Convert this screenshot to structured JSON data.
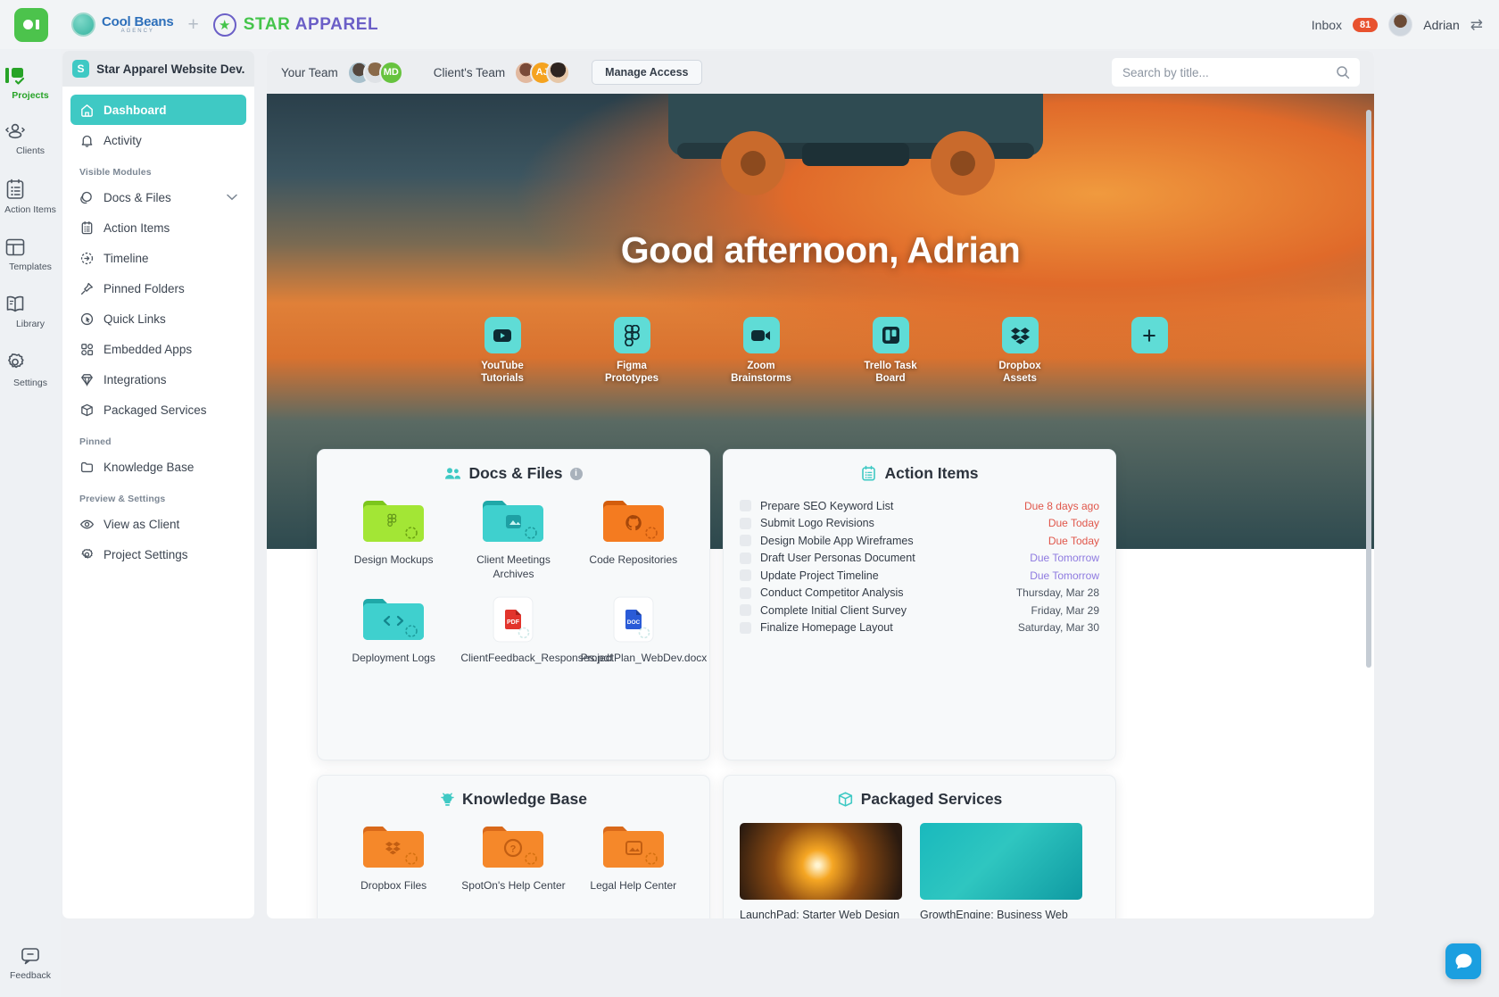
{
  "topbar": {
    "agency_name": "Cool Beans",
    "agency_sub": "AGENCY",
    "brand_part1": "STAR",
    "brand_part2": "APPAREL",
    "inbox_label": "Inbox",
    "inbox_count": "81",
    "user_name": "Adrian"
  },
  "rail": {
    "items": [
      {
        "label": "Projects",
        "icon": "projects-icon"
      },
      {
        "label": "Clients",
        "icon": "clients-icon"
      },
      {
        "label": "Action Items",
        "icon": "action-items-icon"
      },
      {
        "label": "Templates",
        "icon": "templates-icon"
      },
      {
        "label": "Library",
        "icon": "library-icon"
      },
      {
        "label": "Settings",
        "icon": "gear-icon"
      }
    ],
    "feedback_label": "Feedback"
  },
  "sidebar": {
    "project_initial": "S",
    "project_title": "Star Apparel Website Dev...",
    "dashboard_label": "Dashboard",
    "activity_label": "Activity",
    "section_modules": "Visible Modules",
    "section_pinned": "Pinned",
    "section_preview": "Preview & Settings",
    "modules": [
      {
        "label": "Docs & Files",
        "icon": "docs-files-icon",
        "chevron": "⌄"
      },
      {
        "label": "Action Items",
        "icon": "action-items-icon"
      },
      {
        "label": "Timeline",
        "icon": "timeline-icon"
      },
      {
        "label": "Pinned Folders",
        "icon": "pin-icon"
      },
      {
        "label": "Quick Links",
        "icon": "quick-links-icon"
      },
      {
        "label": "Embedded Apps",
        "icon": "embedded-apps-icon"
      },
      {
        "label": "Integrations",
        "icon": "integrations-icon"
      },
      {
        "label": "Packaged Services",
        "icon": "packaged-services-icon"
      }
    ],
    "pinned": [
      {
        "label": "Knowledge Base",
        "icon": "folder-icon"
      }
    ],
    "preview": [
      {
        "label": "View as Client",
        "icon": "eye-icon"
      },
      {
        "label": "Project Settings",
        "icon": "gear-icon"
      }
    ]
  },
  "main_top": {
    "your_team_label": "Your Team",
    "your_team_initials": "MD",
    "clients_team_label": "Client's Team",
    "clients_team_initials": "AJ",
    "manage_access_label": "Manage Access",
    "search_placeholder": "Search by title...",
    "search_value": ""
  },
  "hero": {
    "greeting": "Good afternoon, Adrian",
    "quick_links": [
      {
        "label": "YouTube\nTutorials",
        "line1": "YouTube",
        "line2": "Tutorials",
        "icon": "youtube-icon"
      },
      {
        "label": "Figma Prototypes",
        "line1": "Figma",
        "line2": "Prototypes",
        "icon": "figma-icon"
      },
      {
        "label": "Zoom Brainstorms",
        "line1": "Zoom",
        "line2": "Brainstorms",
        "icon": "zoom-icon"
      },
      {
        "label": "Trello Task Board",
        "line1": "Trello Task",
        "line2": "Board",
        "icon": "trello-icon"
      },
      {
        "label": "Dropbox Assets",
        "line1": "Dropbox",
        "line2": "Assets",
        "icon": "dropbox-icon"
      },
      {
        "label": "Add",
        "line1": "",
        "line2": "",
        "icon": "plus-icon"
      }
    ]
  },
  "docs_files": {
    "title": "Docs & Files",
    "info_glyph": "i",
    "items": [
      {
        "name": "Design Mockups",
        "type": "folder",
        "color": "#a3e635",
        "glyph": "figma-icon"
      },
      {
        "name": "Client Meetings Archives",
        "type": "folder",
        "color": "#3fd0ce",
        "glyph": "image-icon"
      },
      {
        "name": "Code Repositories",
        "type": "folder",
        "color": "#f47b20",
        "glyph": "github-icon"
      },
      {
        "name": "Deployment Logs",
        "type": "folder",
        "color": "#3fd0ce",
        "glyph": "code-icon"
      },
      {
        "name": "ClientFeedback_Responses.pdf",
        "type": "file",
        "color": "#e2342c",
        "glyph": "pdf-icon"
      },
      {
        "name": "ProjectPlan_WebDev.docx",
        "type": "file",
        "color": "#2a5bd7",
        "glyph": "doc-icon"
      }
    ]
  },
  "action_items": {
    "title": "Action Items",
    "rows": [
      {
        "name": "Prepare SEO Keyword List",
        "due": "Due 8 days ago",
        "due_style": "due-red"
      },
      {
        "name": "Submit Logo Revisions",
        "due": "Due Today",
        "due_style": "due-red"
      },
      {
        "name": "Design Mobile App Wireframes",
        "due": "Due Today",
        "due_style": "due-red"
      },
      {
        "name": "Draft User Personas Document",
        "due": "Due Tomorrow",
        "due_style": "due-purple"
      },
      {
        "name": "Update Project Timeline",
        "due": "Due Tomorrow",
        "due_style": "due-purple"
      },
      {
        "name": "Conduct Competitor Analysis",
        "due": "Thursday, Mar 28",
        "due_style": "due-grey"
      },
      {
        "name": "Complete Initial Client Survey",
        "due": "Friday, Mar 29",
        "due_style": "due-grey"
      },
      {
        "name": "Finalize Homepage Layout",
        "due": "Saturday, Mar 30",
        "due_style": "due-grey"
      }
    ]
  },
  "knowledge_base": {
    "title": "Knowledge Base",
    "items": [
      {
        "name": "Dropbox Files",
        "color": "#f5882a",
        "glyph": "dropbox-icon"
      },
      {
        "name": "SpotOn's Help Center",
        "color": "#f5882a",
        "glyph": "question-icon"
      },
      {
        "name": "Legal Help Center",
        "color": "#f5882a",
        "glyph": "image-icon"
      }
    ]
  },
  "packaged_services": {
    "title": "Packaged Services",
    "items": [
      {
        "name": "LaunchPad: Starter Web Design Package\"",
        "image": "spiral-staircase"
      },
      {
        "name": "GrowthEngine: Business Web Development Package",
        "image": "teal-desk"
      }
    ]
  },
  "colors": {
    "accent_teal": "#3fc9c4",
    "brand_green": "#45c44b",
    "brand_purple": "#6b5fc7",
    "badge_red": "#e8522f",
    "chat_blue": "#1b9fe0"
  }
}
